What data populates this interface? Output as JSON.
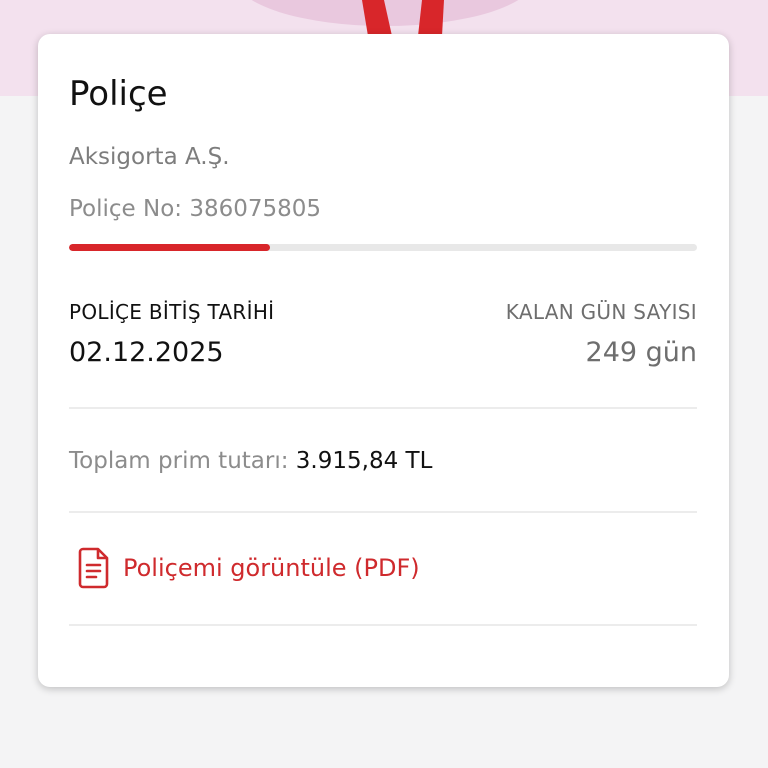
{
  "colors": {
    "accent": "#d8262a",
    "header_band": "#f3e1ee",
    "background": "#f4f4f5",
    "card": "#ffffff"
  },
  "policy_card": {
    "title": "Poliçe",
    "insurer": "Aksigorta A.Ş.",
    "policy_number": "Poliçe No: 386075805",
    "progress_elapsed_fraction": 0.32,
    "end_date_label": "POLİÇE BİTİŞ TARİHİ",
    "end_date_value": "02.12.2025",
    "remaining_days_label": "KALAN GÜN SAYISI",
    "remaining_days_value": "249 gün",
    "premium_label": "Toplam prim tutarı:",
    "premium_value": "3.915,84 TL",
    "pdf_link_icon": "document-icon",
    "pdf_link_label": "Poliçemi görüntüle (PDF)"
  }
}
